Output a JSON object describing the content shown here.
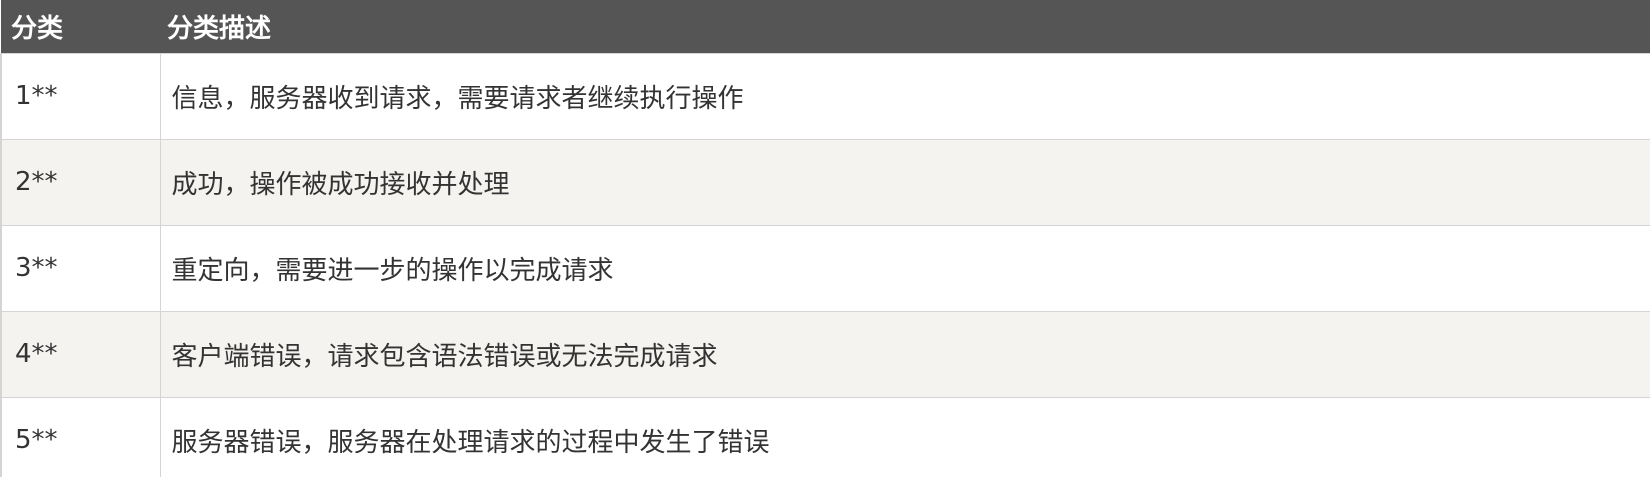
{
  "table": {
    "headers": [
      "分类",
      "分类描述"
    ],
    "rows": [
      {
        "code": "1**",
        "desc": "信息，服务器收到请求，需要请求者继续执行操作"
      },
      {
        "code": "2**",
        "desc": "成功，操作被成功接收并处理"
      },
      {
        "code": "3**",
        "desc": "重定向，需要进一步的操作以完成请求"
      },
      {
        "code": "4**",
        "desc": "客户端错误，请求包含语法错误或无法完成请求"
      },
      {
        "code": "5**",
        "desc": "服务器错误，服务器在处理请求的过程中发生了错误"
      }
    ]
  },
  "colors": {
    "header_bg": "#555555",
    "header_text": "#ffffff",
    "row_alt_bg": "#f4f3f0",
    "border": "#d4d4d4",
    "text": "#333333"
  }
}
